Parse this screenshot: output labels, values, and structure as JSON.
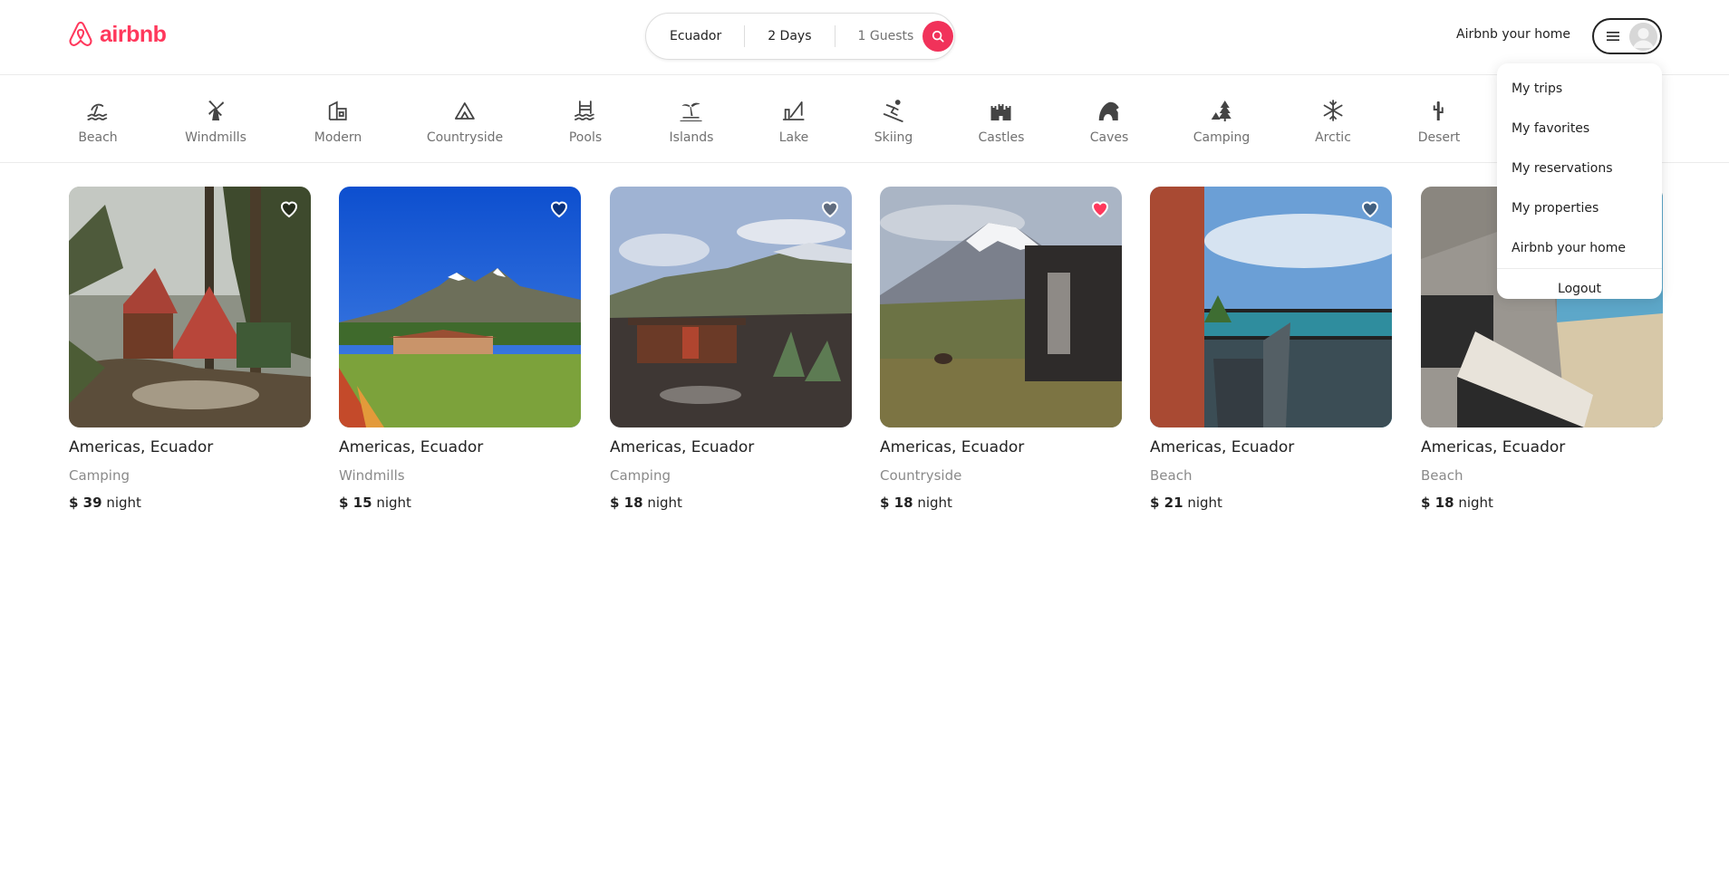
{
  "header": {
    "logo_text": "airbnb",
    "search": {
      "location": "Ecuador",
      "duration": "2 Days",
      "guests": "1 Guests"
    },
    "host_link": "Airbnb your home"
  },
  "categories": [
    {
      "label": "Beach",
      "icon": "beach-icon"
    },
    {
      "label": "Windmills",
      "icon": "windmill-icon"
    },
    {
      "label": "Modern",
      "icon": "modern-icon"
    },
    {
      "label": "Countryside",
      "icon": "countryside-icon"
    },
    {
      "label": "Pools",
      "icon": "pool-icon"
    },
    {
      "label": "Islands",
      "icon": "island-icon"
    },
    {
      "label": "Lake",
      "icon": "lake-icon"
    },
    {
      "label": "Skiing",
      "icon": "skiing-icon"
    },
    {
      "label": "Castles",
      "icon": "castle-icon"
    },
    {
      "label": "Caves",
      "icon": "cave-icon"
    },
    {
      "label": "Camping",
      "icon": "camping-icon"
    },
    {
      "label": "Arctic",
      "icon": "arctic-icon"
    },
    {
      "label": "Desert",
      "icon": "desert-icon"
    }
  ],
  "listings": [
    {
      "location": "Americas, Ecuador",
      "category": "Camping",
      "price": "$ 39",
      "unit": "night",
      "favorited": false
    },
    {
      "location": "Americas, Ecuador",
      "category": "Windmills",
      "price": "$ 15",
      "unit": "night",
      "favorited": false
    },
    {
      "location": "Americas, Ecuador",
      "category": "Camping",
      "price": "$ 18",
      "unit": "night",
      "favorited": false
    },
    {
      "location": "Americas, Ecuador",
      "category": "Countryside",
      "price": "$ 18",
      "unit": "night",
      "favorited": true
    },
    {
      "location": "Americas, Ecuador",
      "category": "Beach",
      "price": "$ 21",
      "unit": "night",
      "favorited": false
    },
    {
      "location": "Americas, Ecuador",
      "category": "Beach",
      "price": "$ 18",
      "unit": "night",
      "favorited": false
    }
  ],
  "user_menu": {
    "items": [
      "My trips",
      "My favorites",
      "My reservations",
      "My properties",
      "Airbnb your home"
    ],
    "logout": "Logout"
  },
  "colors": {
    "brand": "#ff385c",
    "search_button": "#f1325a",
    "favorite_heart": "#ff385c"
  }
}
